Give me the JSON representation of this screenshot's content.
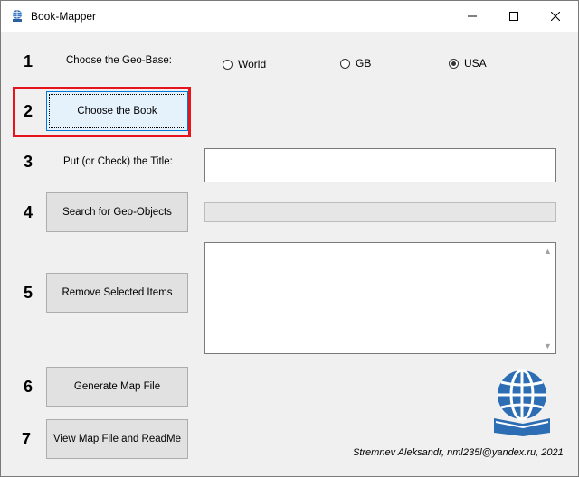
{
  "window": {
    "title": "Book-Mapper",
    "minimize_icon": "minimize-icon",
    "maximize_icon": "maximize-icon",
    "close_icon": "close-icon"
  },
  "steps": {
    "s1": "1",
    "s2": "2",
    "s3": "3",
    "s4": "4",
    "s5": "5",
    "s6": "6",
    "s7": "7"
  },
  "geo_base": {
    "label": "Choose the Geo-Base:",
    "options": [
      "World",
      "GB",
      "USA"
    ],
    "selected": "USA"
  },
  "buttons": {
    "choose_book": "Choose the Book",
    "search": "Search for Geo-Objects",
    "remove": "Remove Selected Items",
    "generate": "Generate Map File",
    "view": "View Map File and ReadMe"
  },
  "title_field": {
    "label": "Put (or Check) the Title:",
    "value": ""
  },
  "progress": {
    "value": 0
  },
  "footer": "Stremnev Aleksandr, nml235l@yandex.ru, 2021",
  "colors": {
    "highlight": "#e8141c",
    "logo_blue": "#2c6db4"
  },
  "icons": {
    "app": "globe-book-icon",
    "logo": "globe-book-logo"
  }
}
